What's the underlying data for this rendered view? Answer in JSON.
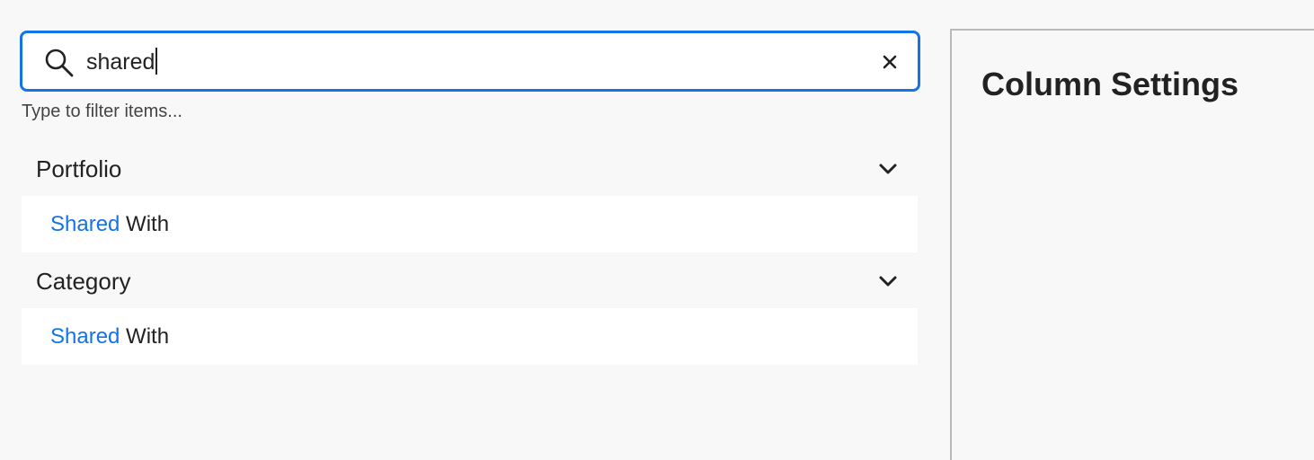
{
  "search": {
    "value": "shared",
    "helper_text": "Type to filter items..."
  },
  "groups": [
    {
      "title": "Portfolio",
      "items": [
        {
          "match": "Shared",
          "rest": " With"
        }
      ]
    },
    {
      "title": "Category",
      "items": [
        {
          "match": "Shared",
          "rest": " With"
        }
      ]
    }
  ],
  "panel": {
    "title": "Column Settings"
  },
  "colors": {
    "accent": "#1473e6",
    "background": "#f8f8f8",
    "text": "#222222"
  },
  "icons": {
    "search": "search-icon",
    "clear": "close-icon",
    "chevron": "chevron-down-icon"
  }
}
